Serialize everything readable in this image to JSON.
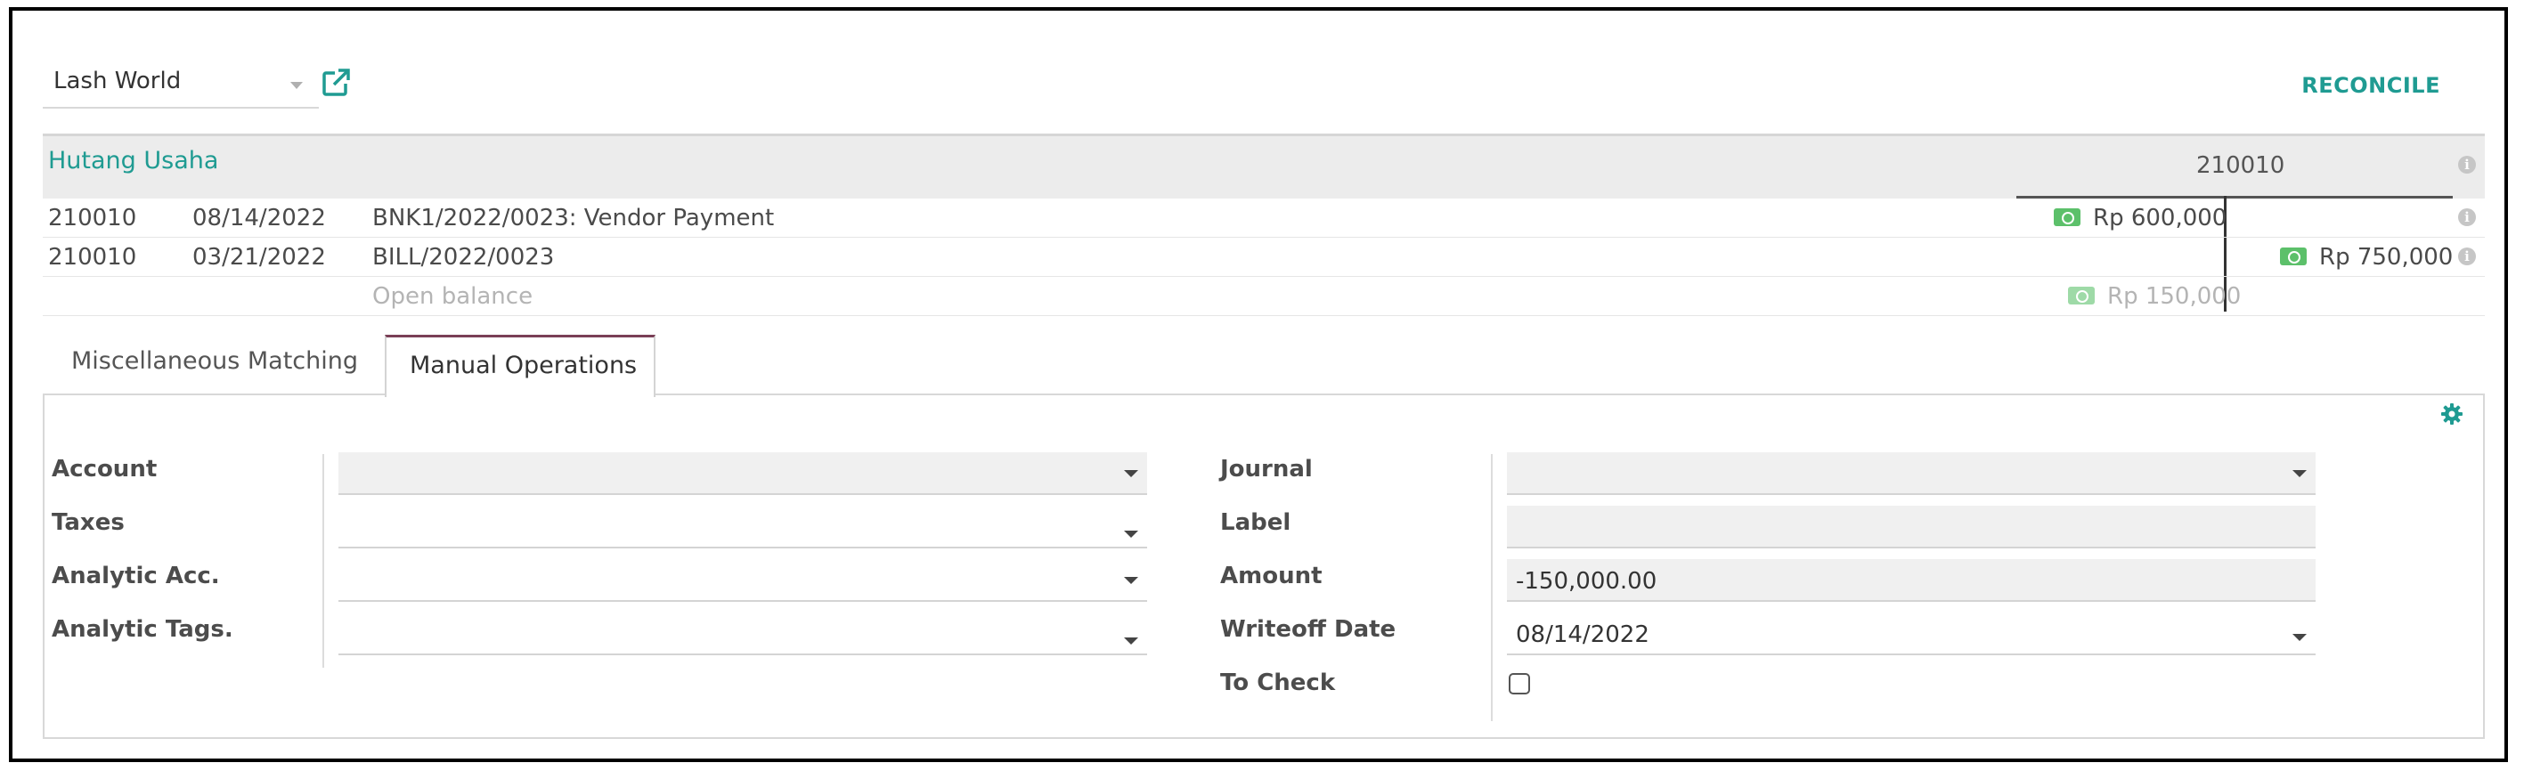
{
  "partner": {
    "name": "Lash World"
  },
  "toolbar": {
    "reconcile_label": "RECONCILE"
  },
  "account": {
    "title": "Hutang Usaha",
    "code": "210010"
  },
  "lines": [
    {
      "account": "210010",
      "date": "08/14/2022",
      "label": "BNK1/2022/0023: Vendor Payment",
      "debit": "Rp 600,000",
      "credit": ""
    },
    {
      "account": "210010",
      "date": "03/21/2022",
      "label": "BILL/2022/0023",
      "debit": "",
      "credit": "Rp 750,000"
    }
  ],
  "open_balance": {
    "label": "Open balance",
    "amount": "Rp 150,000"
  },
  "tabs": [
    {
      "label": "Miscellaneous Matching",
      "active": false
    },
    {
      "label": "Manual Operations",
      "active": true
    }
  ],
  "form": {
    "left": {
      "account_label": "Account",
      "taxes_label": "Taxes",
      "analytic_acc_label": "Analytic Acc.",
      "analytic_tags_label": "Analytic Tags."
    },
    "right": {
      "journal_label": "Journal",
      "label_label": "Label",
      "amount_label": "Amount",
      "amount_value": "-150,000.00",
      "writeoff_date_label": "Writeoff Date",
      "writeoff_date_value": "08/14/2022",
      "to_check_label": "To Check",
      "to_check_checked": false
    }
  },
  "colors": {
    "accent": "#1f9b92",
    "money": "#5cc06a",
    "tab_active": "#7a3f56"
  },
  "icons": [
    "external-link-icon",
    "info-icon",
    "money-icon",
    "gear-icon",
    "chevron-down-icon"
  ]
}
